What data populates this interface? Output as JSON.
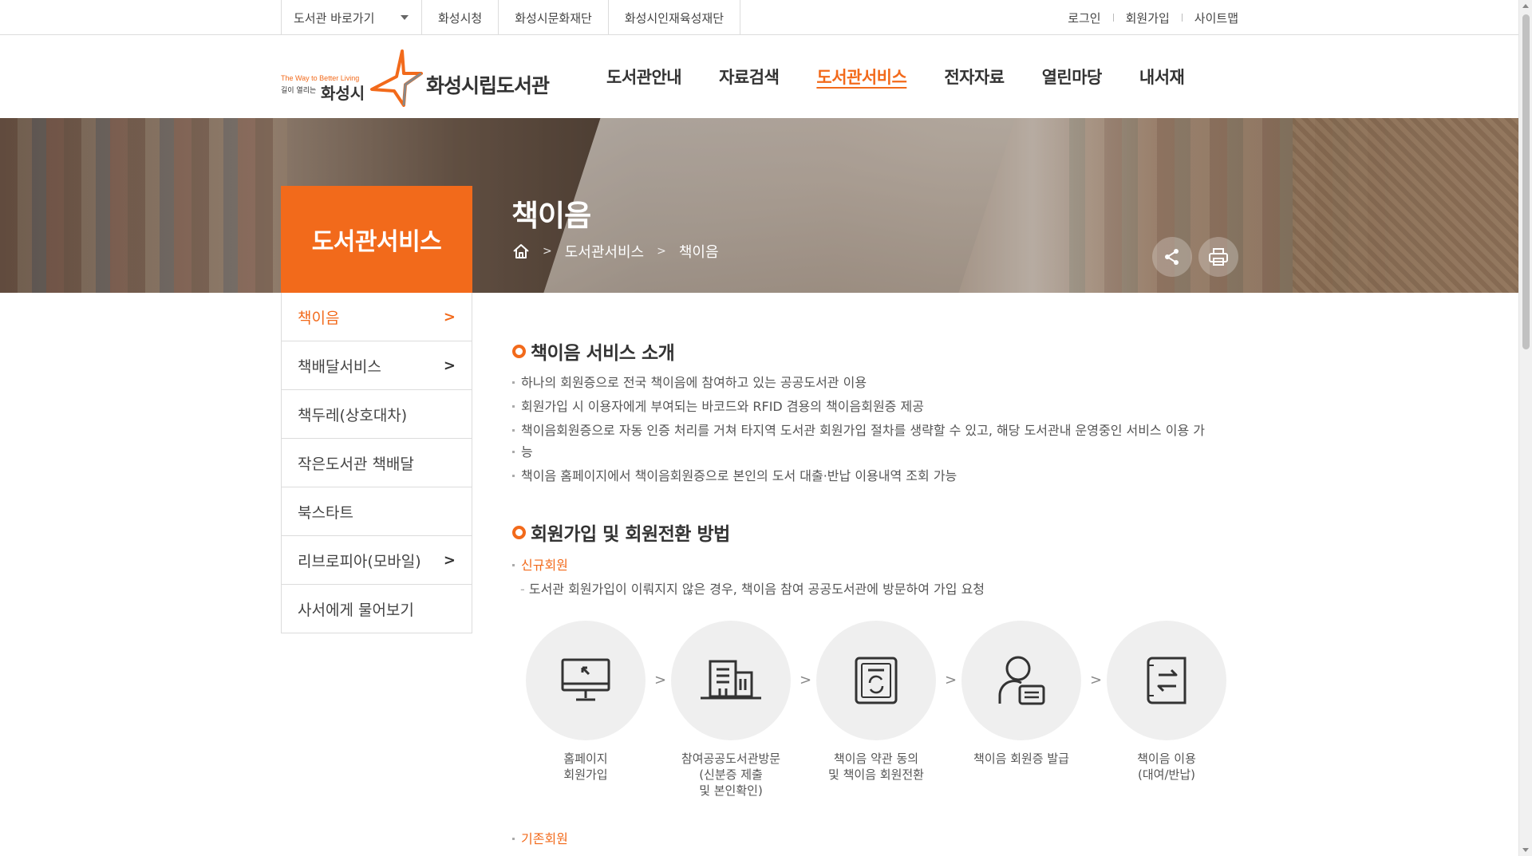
{
  "topbar": {
    "quick_select": "도서관 바로가기",
    "links": [
      "화성시청",
      "화성시문화재단",
      "화성시인재육성재단"
    ],
    "user_menu": [
      "로그인",
      "회원가입",
      "사이트맵"
    ]
  },
  "logo": {
    "slogan": "The Way to Better Living",
    "slogan2": "길이 열리는",
    "city": "화성시",
    "library": "화성시립도서관"
  },
  "gnb": [
    "도서관안내",
    "자료검색",
    "도서관서비스",
    "전자자료",
    "열린마당",
    "내서재"
  ],
  "gnb_active": "도서관서비스",
  "banner": {
    "side_title": "도서관서비스",
    "page_title": "책이음",
    "breadcrumb": [
      "도서관서비스",
      "책이음"
    ]
  },
  "lnb": [
    {
      "label": "책이음",
      "arrow": true,
      "active": true
    },
    {
      "label": "책배달서비스",
      "arrow": true,
      "active": false
    },
    {
      "label": "책두레(상호대차)",
      "arrow": false,
      "active": false
    },
    {
      "label": "작은도서관 책배달",
      "arrow": false,
      "active": false
    },
    {
      "label": "북스타트",
      "arrow": false,
      "active": false
    },
    {
      "label": "리브로피아(모바일)",
      "arrow": true,
      "active": false
    },
    {
      "label": "사서에게 물어보기",
      "arrow": false,
      "active": false
    }
  ],
  "section1": {
    "title": "책이음 서비스 소개",
    "items": [
      "하나의 회원증으로 전국 책이음에 참여하고 있는 공공도서관 이용",
      "회원가입 시 이용자에게 부여되는 바코드와 RFID 겸용의 책이음회원증 제공",
      "책이음회원증으로 자동 인증 처리를 거쳐 타지역 도서관 회원가입 절차를 생략할 수 있고, 해당 도서관내 운영중인 서비스 이용 가",
      "능",
      "책이음 홈페이지에서 책이음회원증으로 본인의 도서 대출·반납 이용내역 조회 가능"
    ]
  },
  "section2": {
    "title": "회원가입 및 회원전환 방법",
    "new_member": "신규회원",
    "new_member_desc": "도서관 회원가입이 이뤄지지 않은 경우, 책이음 참여 공공도서관에 방문하여 가입 요청",
    "steps": [
      {
        "icon": "monitor-icon",
        "label": "홈페이지\n회원가입"
      },
      {
        "icon": "building-icon",
        "label": "참여공공도서관방문\n(신분증 제출\n및 본인확인)"
      },
      {
        "icon": "card-refresh-icon",
        "label": "책이음 약관 동의\n및 책이음 회원전환"
      },
      {
        "icon": "user-card-icon",
        "label": "책이음 회원증 발급"
      },
      {
        "icon": "exchange-book-icon",
        "label": "책이음 이용\n(대여/반납)"
      }
    ],
    "existing_member": "기존회원"
  },
  "colors": {
    "accent": "#f26a1b",
    "text": "#333333",
    "circle": "#efefef"
  }
}
